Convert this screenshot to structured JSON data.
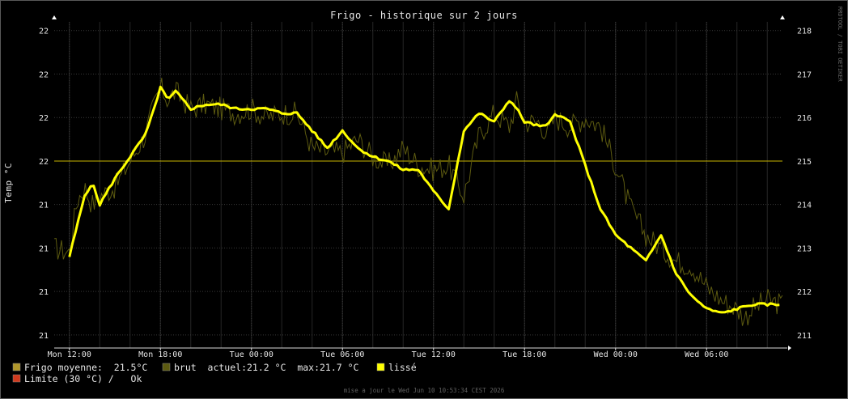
{
  "chart_data": {
    "type": "line",
    "title": "Frigo - historique sur 2 jours",
    "ylabel": "Temp °C",
    "vertical_label": "RRDTOOL / TOBI OETIKER",
    "left_ticks": [
      "22",
      "22",
      "22",
      "22",
      "21",
      "21",
      "21",
      "21"
    ],
    "right_ticks": [
      "218",
      "217",
      "216",
      "215",
      "214",
      "213",
      "212",
      "211"
    ],
    "x_ticks": [
      "Mon 12:00",
      "Mon 18:00",
      "Tue 00:00",
      "Tue 06:00",
      "Tue 12:00",
      "Tue 18:00",
      "Wed 00:00",
      "Wed 06:00"
    ],
    "ylim": [
      210.7,
      218.2
    ],
    "xlim_hours": [
      -1,
      47
    ],
    "tick_hours": [
      0,
      6,
      12,
      18,
      24,
      30,
      36,
      42
    ],
    "grid": true,
    "limit_line": {
      "value": 215,
      "color": "#c8b400"
    },
    "series": [
      {
        "name": "brut",
        "color": "#5c5a10",
        "hours": [
          -1,
          0,
          0.5,
          1,
          1.5,
          2,
          3,
          4,
          5,
          5.5,
          6,
          6.5,
          7,
          8,
          9,
          10,
          11,
          12,
          13,
          14,
          15,
          16,
          17,
          18,
          19,
          20,
          20.5,
          21,
          22,
          23,
          24,
          25,
          26,
          27,
          28,
          29,
          29.5,
          30,
          31,
          31.5,
          32,
          33,
          34,
          35,
          36,
          37,
          38,
          39,
          40,
          41,
          42,
          43,
          44,
          44.5,
          45,
          46,
          47
        ],
        "values": [
          213.0,
          212.9,
          214.1,
          214.4,
          214.0,
          214.2,
          214.4,
          215.0,
          215.6,
          216.2,
          216.7,
          216.4,
          216.6,
          216.2,
          216.3,
          216.2,
          216.1,
          216.2,
          216.0,
          216.1,
          216.1,
          215.3,
          215.2,
          215.2,
          215.5,
          215.1,
          215.0,
          214.9,
          215.3,
          214.9,
          214.8,
          214.9,
          214.2,
          215.6,
          216.1,
          215.8,
          216.4,
          215.9,
          215.9,
          215.6,
          216.0,
          215.8,
          216.0,
          215.8,
          214.9,
          213.9,
          213.3,
          213.0,
          212.7,
          212.6,
          212.1,
          211.8,
          211.6,
          211.4,
          211.6,
          211.8,
          211.7
        ]
      },
      {
        "name": "lissé",
        "color": "#ffff00",
        "hours": [
          0,
          0.5,
          1,
          1.5,
          2,
          3,
          4,
          5,
          5.5,
          6,
          6.5,
          7,
          7.5,
          8,
          9,
          10,
          11,
          12,
          13,
          14,
          15,
          16,
          17,
          18,
          19,
          20,
          21,
          22,
          23,
          24,
          25,
          26,
          27,
          28,
          29,
          29.5,
          30,
          31,
          31.5,
          32,
          33,
          34,
          35,
          36,
          37,
          38,
          39,
          40,
          41,
          42,
          43,
          44,
          45,
          46,
          47
        ],
        "values": [
          212.8,
          213.5,
          214.2,
          214.5,
          214.0,
          214.6,
          215.1,
          215.6,
          216.1,
          216.7,
          216.4,
          216.6,
          216.4,
          216.2,
          216.3,
          216.3,
          216.2,
          216.2,
          216.2,
          216.1,
          216.1,
          215.7,
          215.3,
          215.7,
          215.3,
          215.1,
          215.0,
          214.8,
          214.8,
          214.3,
          213.9,
          215.7,
          216.1,
          215.9,
          216.4,
          216.2,
          215.9,
          215.8,
          215.8,
          216.1,
          215.9,
          214.9,
          213.9,
          213.3,
          213.0,
          212.7,
          213.3,
          212.4,
          211.9,
          211.6,
          211.5,
          211.6,
          211.7,
          211.7,
          211.7
        ]
      }
    ]
  },
  "legend": [
    {
      "label": "Frigo moyenne:  21.5°C",
      "color": "#b0962a"
    },
    {
      "label": "brut  actuel:21.2 °C  max:21.7 °C",
      "color": "#5c5a10"
    },
    {
      "label": "lissé",
      "color": "#ffff00"
    },
    {
      "label": "Limite (30 °C) /   Ok",
      "color": "#d03a1e"
    }
  ],
  "footer": "mise a jour le Wed Jun 10 10:53:34 CEST 2026",
  "colors": {
    "background": "#000000",
    "grid": "#3a3a3a",
    "axis": "#d8d8d8"
  }
}
